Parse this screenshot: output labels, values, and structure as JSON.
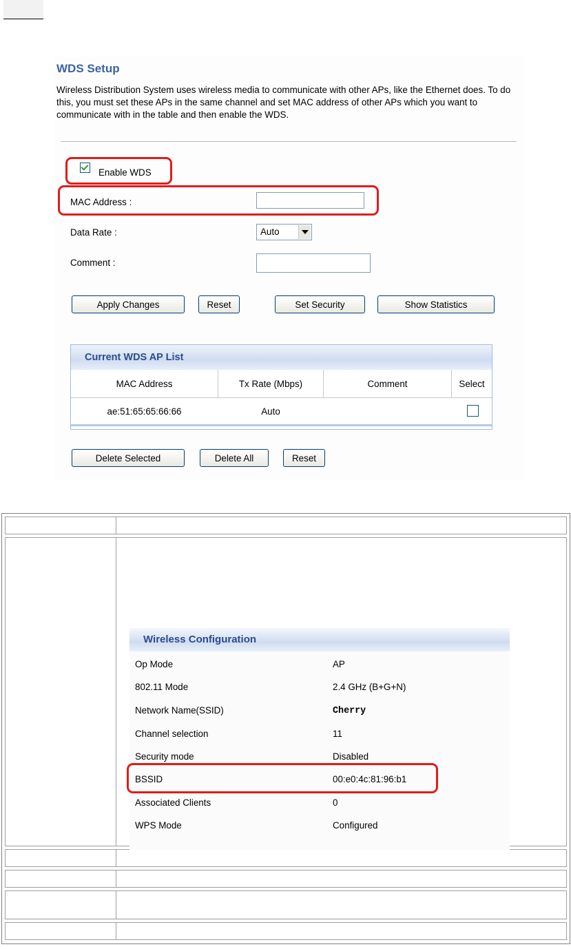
{
  "wds_setup": {
    "title": "WDS Setup",
    "description": "Wireless Distribution System uses wireless media to communicate with other APs, like the Ethernet does. To do this, you must set these APs in the same channel and set MAC address of other APs which you want to communicate with in the table and then enable the WDS.",
    "enable_wds_label": "Enable WDS",
    "enable_wds_checked": true,
    "mac_address_label": "MAC Address :",
    "mac_address_value": "",
    "data_rate_label": "Data Rate :",
    "data_rate_value": "Auto",
    "comment_label": "Comment :",
    "comment_value": "",
    "buttons": {
      "apply": "Apply Changes",
      "reset": "Reset",
      "set_security": "Set Security",
      "show_statistics": "Show Statistics"
    },
    "ap_list": {
      "title": "Current WDS AP List",
      "columns": [
        "MAC Address",
        "Tx Rate (Mbps)",
        "Comment",
        "Select"
      ],
      "rows": [
        {
          "mac": "ae:51:65:65:66:66",
          "tx_rate": "Auto",
          "comment": "",
          "selected": false
        }
      ]
    },
    "list_buttons": {
      "delete_selected": "Delete Selected",
      "delete_all": "Delete All",
      "reset": "Reset"
    }
  },
  "wireless_configuration": {
    "title": "Wireless Configuration",
    "rows": [
      {
        "key": "Op Mode",
        "value": "AP"
      },
      {
        "key": "802.11 Mode",
        "value": "2.4 GHz (B+G+N)"
      },
      {
        "key": "Network Name(SSID)",
        "value": "Cherry"
      },
      {
        "key": "Channel selection",
        "value": "11"
      },
      {
        "key": "Security mode",
        "value": "Disabled"
      },
      {
        "key": "BSSID",
        "value": "00:e0:4c:81:96:b1"
      },
      {
        "key": "Associated Clients",
        "value": "0"
      },
      {
        "key": "WPS Mode",
        "value": "Configured"
      }
    ]
  },
  "colors": {
    "title_blue": "#3a63a3",
    "highlight_red": "#e01b1b",
    "panel_header_blue": "#2d4c8a"
  }
}
